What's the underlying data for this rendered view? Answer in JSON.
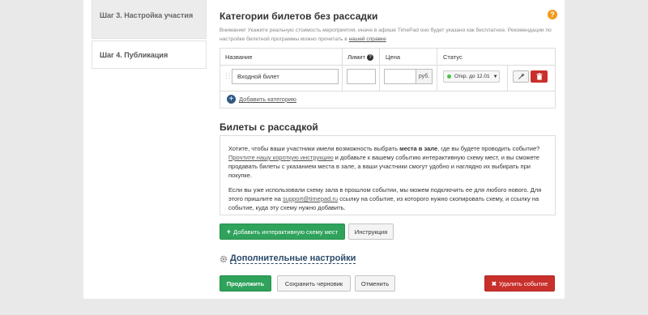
{
  "sidebar": {
    "steps": [
      {
        "label": "Шаг 3. Настройка участия",
        "active": true
      },
      {
        "label": "Шаг 4. Публикация",
        "active": false
      }
    ]
  },
  "categories": {
    "title": "Категории билетов без рассадки",
    "notice_text": "Внимание! Укажите реальную стоимость мероприятия, иначе в афише TimePad оно будет указано как бесплатное. Рекомендации по настройке билетной программы можно прочитать в ",
    "notice_link": "нашей справке",
    "columns": {
      "name": "Название",
      "limit": "Лимит",
      "price": "Цена",
      "status": "Статус"
    },
    "rows": [
      {
        "name": "Входной билет",
        "limit": "",
        "price": "",
        "currency": "руб.",
        "status": "Откр. до 12.01"
      }
    ],
    "add_label": "Добавить категорию"
  },
  "seating": {
    "title": "Билеты с рассадкой",
    "p1_a": "Хотите, чтобы ваши участники имели возможность выбрать ",
    "p1_bold": "места в зале",
    "p1_b": ", где вы будете проводить событие? ",
    "p1_link": "Прочтите нашу короткую инструкцию",
    "p1_c": " и добавьте к вашему событию интерактивную схему мест, и вы сможете продавать билеты с указанием места в зале, а ваши участники смогут удобно и наглядно их выбирать при покупке.",
    "p2_a": "Если вы уже использовали схему зала в прошлом событии, мы можем подключить ее для любого нового. Для этого пришлите на ",
    "p2_link": "support@timepad.ru",
    "p2_b": " ссылку на событие, из которого нужно скопировать схему, и ссылку на событие, куда эту схему нужно добавить.",
    "add_scheme_label": "Добавить интерактивную схему мест",
    "instruction_label": "Инструкция"
  },
  "extra_settings_label": "Дополнительные настройки",
  "actions": {
    "continue": "Продолжить",
    "save_draft": "Сохранить черновик",
    "cancel": "Отменить",
    "delete_event": "Удалить событие"
  },
  "colors": {
    "accent_green": "#2fa25b",
    "danger_red": "#c9302c",
    "help_orange": "#f29a1a",
    "link_blue": "#2b4a6a"
  }
}
